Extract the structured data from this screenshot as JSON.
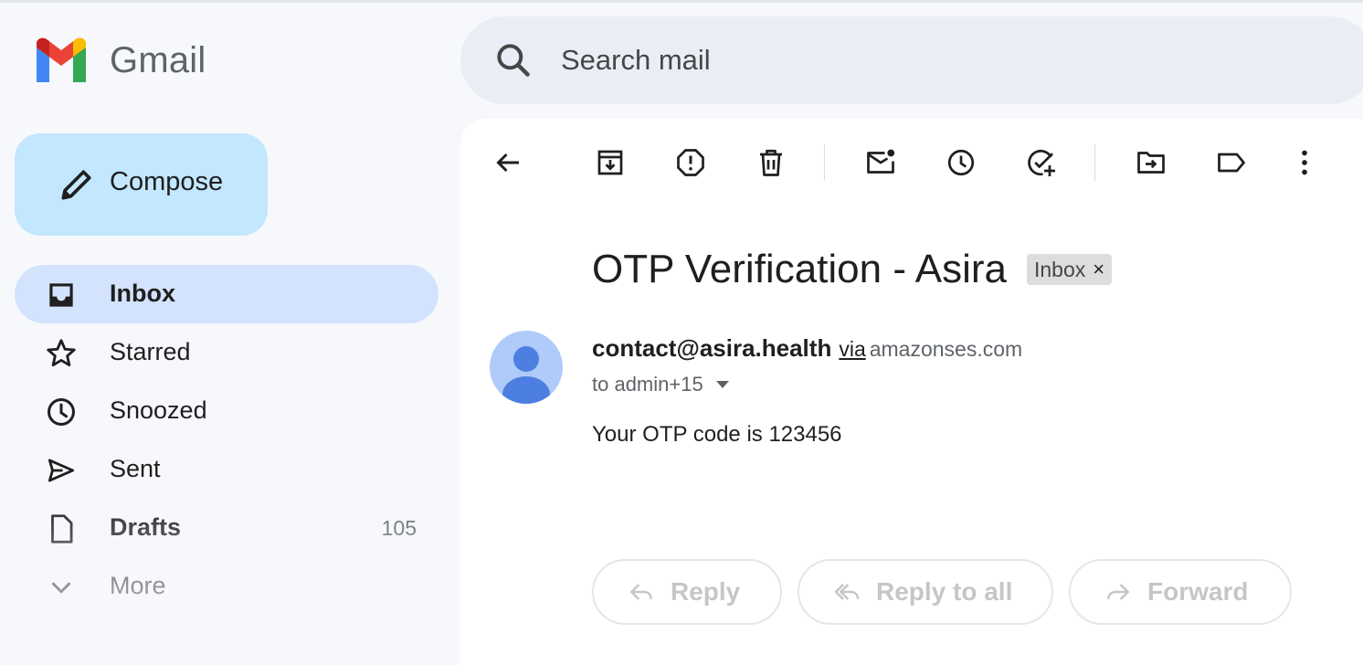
{
  "app": {
    "name": "Gmail"
  },
  "search": {
    "placeholder": "Search mail"
  },
  "compose": {
    "label": "Compose"
  },
  "nav": {
    "items": [
      {
        "label": "Inbox",
        "icon": "inbox-icon",
        "active": true
      },
      {
        "label": "Starred",
        "icon": "star-icon"
      },
      {
        "label": "Snoozed",
        "icon": "clock-icon"
      },
      {
        "label": "Sent",
        "icon": "send-icon"
      },
      {
        "label": "Drafts",
        "icon": "draft-icon",
        "count": "105"
      },
      {
        "label": "More",
        "icon": "chevron-down-icon"
      }
    ]
  },
  "toolbar": {
    "icons": [
      "back-arrow-icon",
      "archive-icon",
      "report-spam-icon",
      "delete-icon",
      "mark-unread-icon",
      "snooze-icon",
      "add-to-tasks-icon",
      "move-to-icon",
      "label-icon",
      "more-vert-icon"
    ]
  },
  "email": {
    "subject": "OTP Verification - Asira",
    "label": "Inbox",
    "label_remove": "×",
    "sender": "contact@asira.health",
    "via": "via",
    "via_domain": "amazonses.com",
    "to": "to admin+15",
    "body": "Your OTP code is 123456"
  },
  "actions": {
    "reply": "Reply",
    "reply_all": "Reply to all",
    "forward": "Forward"
  },
  "colors": {
    "background": "#f6f8fc",
    "compose": "#c2e7ff",
    "active_nav": "#d3e3fd",
    "search": "#e9eef6",
    "avatar": "#aecbfa",
    "avatar_fg": "#4c7fe0"
  }
}
